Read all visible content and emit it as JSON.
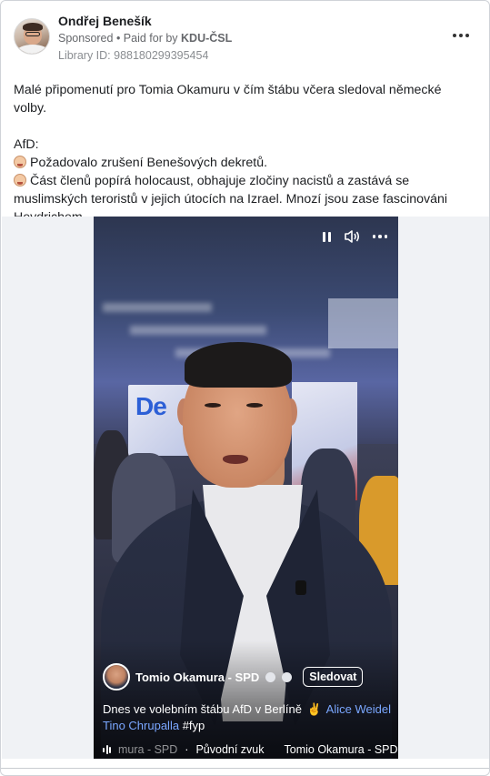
{
  "post": {
    "author": "Ondřej Benešík",
    "sponsored": "Sponsored",
    "paid_for_prefix": "• Paid for by ",
    "paid_for_by": "KDU-ČSL",
    "library_id": "Library ID: 988180299395454",
    "more_icon": "more-horizontal-icon",
    "text_line1": "Malé připomenutí pro Tomia Okamuru v čím štábu včera sledoval německé volby.",
    "text_line2": "AfD:",
    "bullet1": "Požadovalo zrušení Benešových dekretů.",
    "bullet2": "Část členů popírá holocaust, obhajuje zločiny nacistů a zastává se muslimských teroristů v jejich útocích na Izrael. Mnozí jsou zase fascinováni Heydrichem.…"
  },
  "video": {
    "screen_text": "De",
    "channel_name": "Tomio Okamura - SPD",
    "follow_label": "Sledovat",
    "caption_text": "Dnes ve volebním štábu AfD v Berlíně",
    "caption_victory": "✌",
    "tag1": "Alice Weidel",
    "tag2": "Tino Chrupalla",
    "hashtag": "#fyp",
    "audio_faded": "mura - SPD",
    "audio_dot": "·",
    "audio_label": "Původní zvuk",
    "audio_next": "Tomio Okamura - SPD",
    "controls": [
      "pause-icon",
      "volume-icon",
      "more-horizontal-icon"
    ]
  },
  "colors": {
    "tag_link": "#7aa7ff",
    "meta_gray": "#65676b"
  }
}
